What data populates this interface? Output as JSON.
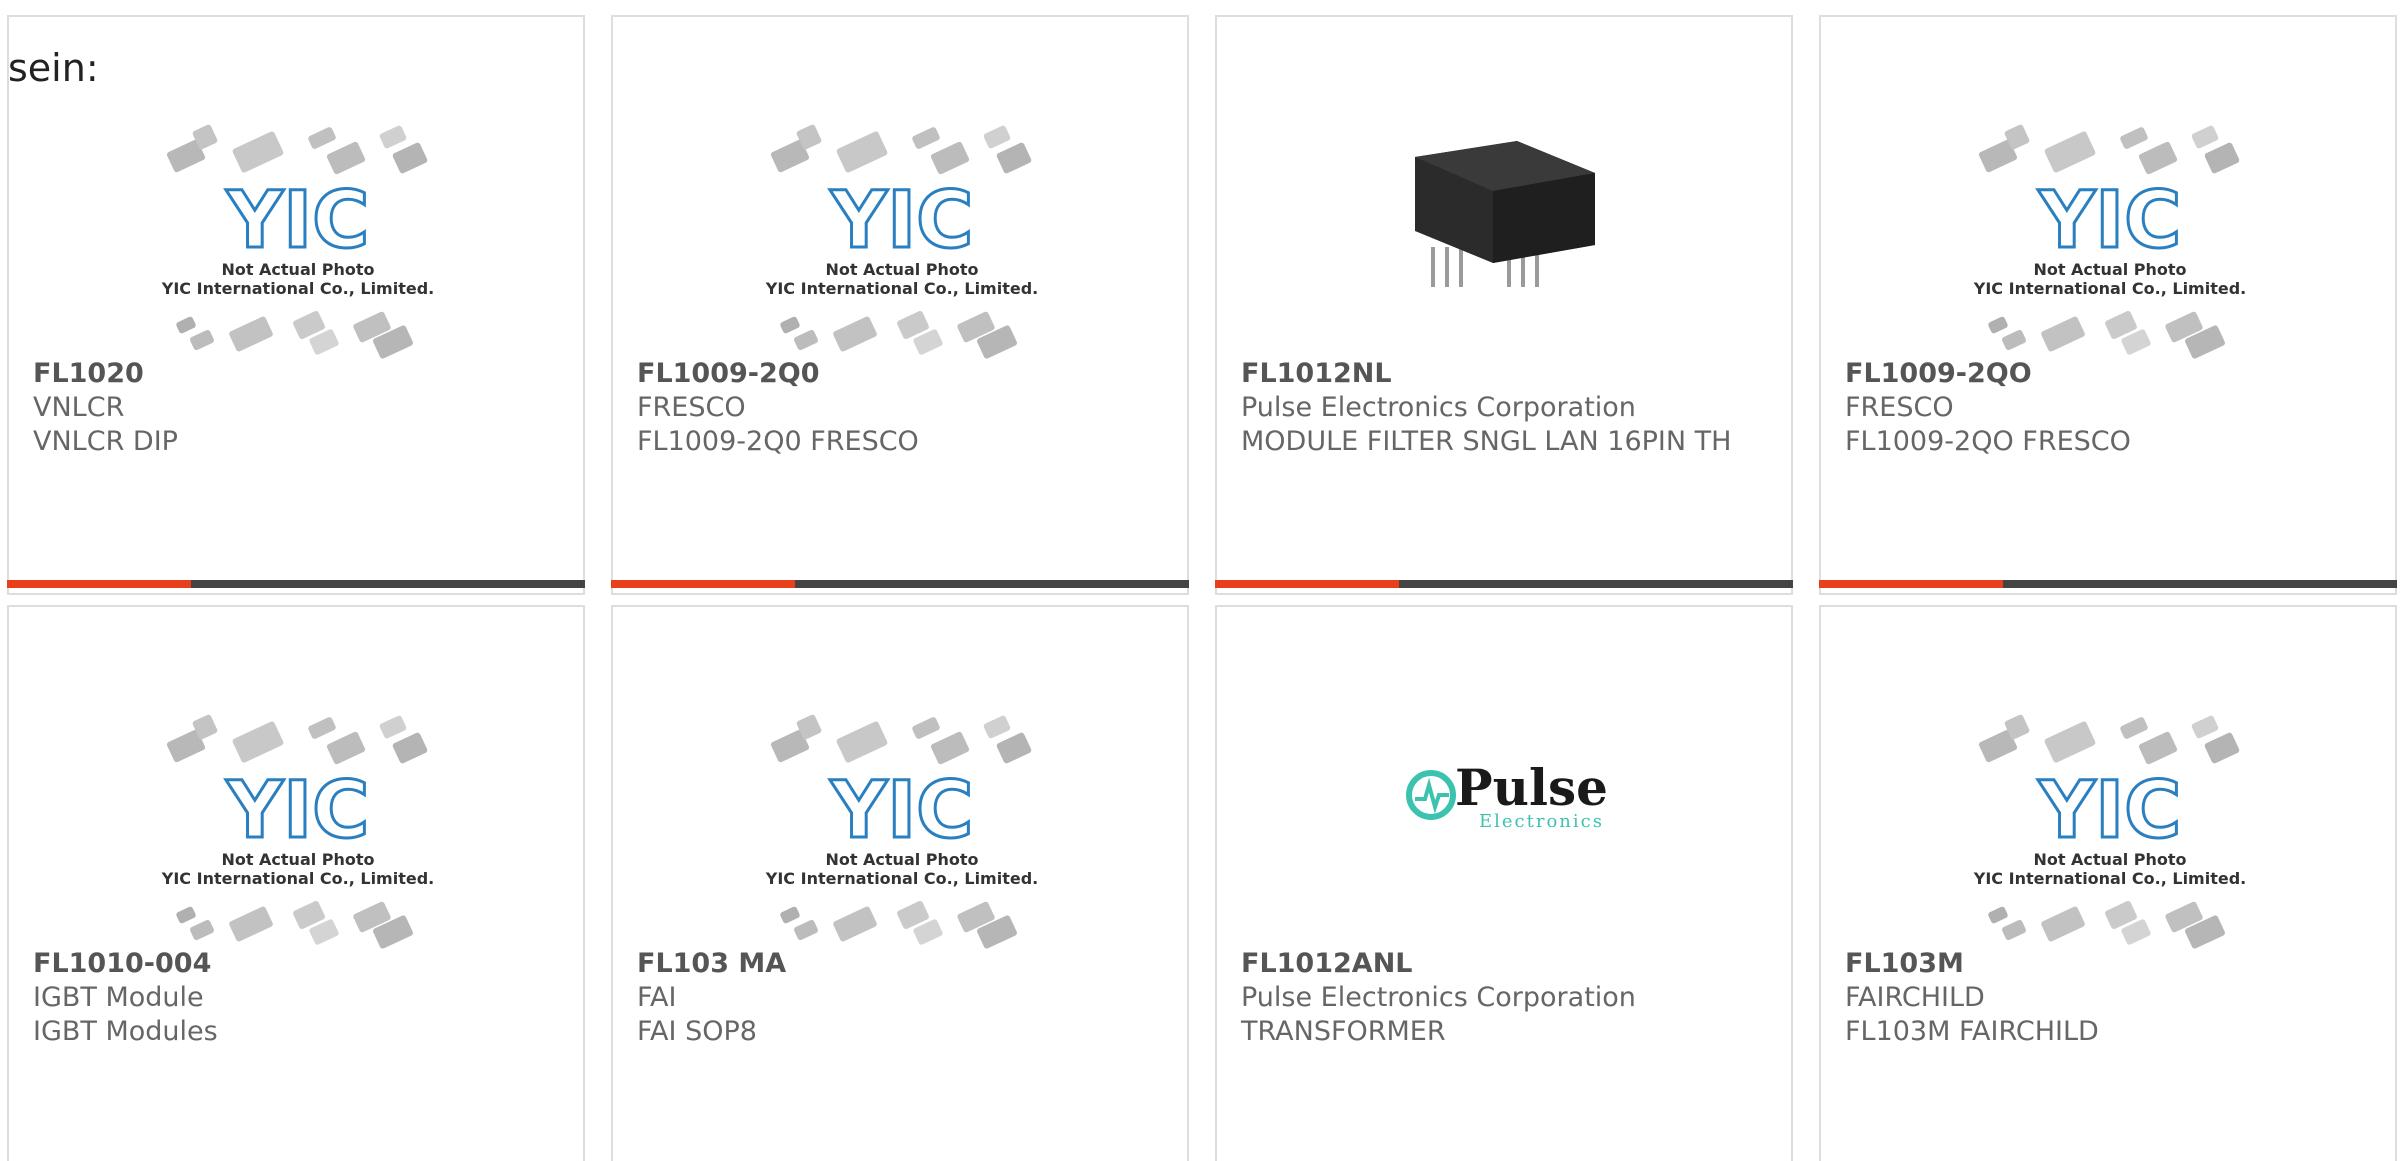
{
  "intro_text": "sein:",
  "colors": {
    "accent": "#e8401c",
    "bar": "#444444",
    "yic_blue": "#2a7fc0",
    "pulse_teal": "#3cc3b0"
  },
  "placeholder": {
    "line1": "Not Actual Photo",
    "line2": "YIC International Co., Limited."
  },
  "pulse_logo": {
    "name": "Pulse",
    "sub": "Electronics"
  },
  "products": [
    {
      "part": "FL1020",
      "maker": "VNLCR",
      "desc": "VNLCR DIP",
      "image": "yic-placeholder"
    },
    {
      "part": "FL1009-2Q0",
      "maker": "FRESCO",
      "desc": "FL1009-2Q0 FRESCO",
      "image": "yic-placeholder"
    },
    {
      "part": "FL1012NL",
      "maker": "Pulse Electronics Corporation",
      "desc": "MODULE FILTER SNGL LAN 16PIN TH",
      "image": "module-photo"
    },
    {
      "part": "FL1009-2QO",
      "maker": "FRESCO",
      "desc": "FL1009-2QO FRESCO",
      "image": "yic-placeholder"
    },
    {
      "part": "FL1010-004",
      "maker": "IGBT Module",
      "desc": "IGBT Modules",
      "image": "yic-placeholder"
    },
    {
      "part": "FL103 MA",
      "maker": "FAI",
      "desc": "FAI SOP8",
      "image": "yic-placeholder"
    },
    {
      "part": "FL1012ANL",
      "maker": "Pulse Electronics Corporation",
      "desc": "TRANSFORMER",
      "image": "pulse-logo"
    },
    {
      "part": "FL103M",
      "maker": "FAIRCHILD",
      "desc": "FL103M FAIRCHILD",
      "image": "yic-placeholder"
    }
  ]
}
